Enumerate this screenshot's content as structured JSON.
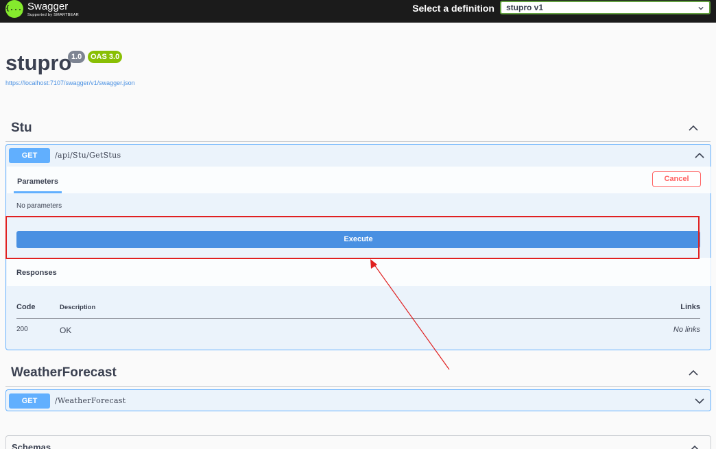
{
  "header": {
    "logo_glyph": "{...}",
    "logo_name": "Swagger",
    "logo_tagline": "Supported by SMARTBEAR",
    "definition_label": "Select a definition",
    "definition_selected": "stupro v1",
    "accent_color": "#85ea2d"
  },
  "info": {
    "title": "stupro",
    "version": "1.0",
    "oas_version": "OAS 3.0",
    "spec_url": "https://localhost:7107/swagger/v1/swagger.json"
  },
  "tags": [
    {
      "name": "Stu",
      "operations": [
        {
          "method": "GET",
          "path": "/api/Stu/GetStus",
          "expanded": true,
          "parameters_tab": "Parameters",
          "cancel_label": "Cancel",
          "no_parameters": "No parameters",
          "execute_label": "Execute",
          "responses_title": "Responses",
          "responses_columns": [
            "Code",
            "Description",
            "Links"
          ],
          "responses": [
            {
              "code": "200",
              "description": "OK",
              "links": "No links"
            }
          ]
        }
      ]
    },
    {
      "name": "WeatherForecast",
      "operations": [
        {
          "method": "GET",
          "path": "/WeatherForecast",
          "expanded": false
        }
      ]
    }
  ],
  "schemas_title": "Schemas",
  "colors": {
    "get_method": "#61affe",
    "execute": "#4990e2",
    "cancel": "#ff6060",
    "annotation": "#e02020"
  }
}
